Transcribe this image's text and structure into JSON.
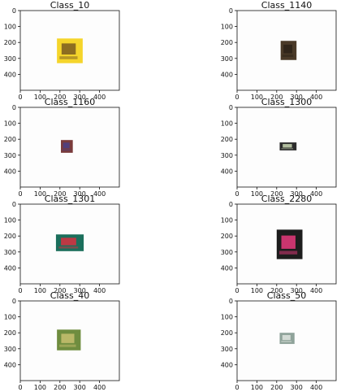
{
  "figure": {
    "panels": [
      {
        "title": "Class_10",
        "thumb_color": "#f5d52b",
        "thumb_accent": "#7a5a20",
        "thumb_extent": {
          "x": [
            185,
            315
          ],
          "y": [
            175,
            330
          ]
        }
      },
      {
        "title": "Class_1140",
        "thumb_color": "#4a3a28",
        "thumb_accent": "#2b2218",
        "thumb_extent": {
          "x": [
            220,
            300
          ],
          "y": [
            190,
            310
          ]
        }
      },
      {
        "title": "Class_1160",
        "thumb_color": "#7a3b3b",
        "thumb_accent": "#4b3f86",
        "thumb_extent": {
          "x": [
            205,
            265
          ],
          "y": [
            205,
            285
          ]
        }
      },
      {
        "title": "Class_1300",
        "thumb_color": "#2c2c2c",
        "thumb_accent": "#c9d7b3",
        "thumb_extent": {
          "x": [
            215,
            300
          ],
          "y": [
            220,
            270
          ]
        }
      },
      {
        "title": "Class_1301",
        "thumb_color": "#1b6f5c",
        "thumb_accent": "#d9303f",
        "thumb_extent": {
          "x": [
            180,
            320
          ],
          "y": [
            190,
            295
          ]
        }
      },
      {
        "title": "Class_2280",
        "thumb_color": "#1d1d1d",
        "thumb_accent": "#e83a7d",
        "thumb_extent": {
          "x": [
            200,
            330
          ],
          "y": [
            160,
            345
          ]
        }
      },
      {
        "title": "Class_40",
        "thumb_color": "#6f8d3f",
        "thumb_accent": "#c8c070",
        "thumb_extent": {
          "x": [
            185,
            305
          ],
          "y": [
            180,
            310
          ]
        }
      },
      {
        "title": "Class_50",
        "thumb_color": "#8fa39a",
        "thumb_accent": "#dfe5df",
        "thumb_extent": {
          "x": [
            215,
            290
          ],
          "y": [
            200,
            270
          ]
        }
      }
    ],
    "axes": {
      "x_ticks": [
        0,
        100,
        200,
        300,
        400
      ],
      "y_ticks": [
        0,
        100,
        200,
        300,
        400
      ],
      "xlim": [
        0,
        500
      ],
      "ylim": [
        500,
        0
      ]
    }
  }
}
